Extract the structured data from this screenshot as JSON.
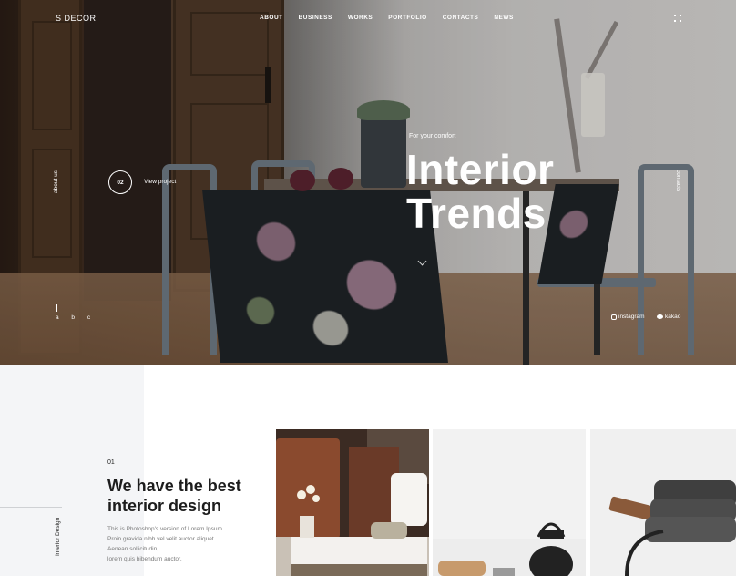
{
  "header": {
    "logo": "S DECOR",
    "nav": [
      "ABOUT",
      "BUSINESS",
      "WORKS",
      "PORTFOLIO",
      "CONTACTS",
      "NEWS"
    ],
    "menu_icon": "grid-dots-icon"
  },
  "hero": {
    "side_left": "about us",
    "side_right": "contacts",
    "slide_number": "02",
    "view_project": "View project",
    "eyebrow": "For your comfort",
    "title_line1": "Interior",
    "title_line2": "Trends",
    "abc": "a b c",
    "social": [
      {
        "icon": "instagram-icon",
        "label": "instagram"
      },
      {
        "icon": "kakao-bubble-icon",
        "label": "kakao"
      }
    ]
  },
  "section": {
    "vertical_label": "Interior Design",
    "number": "01",
    "title_line1": "We have the best",
    "title_line2": "interior design",
    "body": [
      "This is Photoshop's version  of Lorem Ipsum.",
      "Proin gravida nibh vel velit auctor aliquet.",
      "Aenean sollicitudin,",
      "lorem quis bibendum auctor,"
    ]
  },
  "colors": {
    "accent": "#ffffff",
    "dark": "#1d1d1d",
    "muted": "#7a7a7a",
    "panel": "#f4f5f7"
  }
}
